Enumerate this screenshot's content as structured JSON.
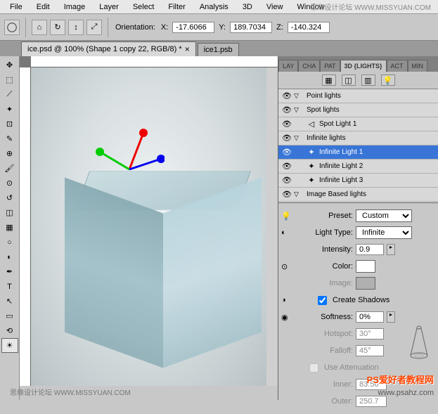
{
  "menu": {
    "file": "File",
    "edit": "Edit",
    "image": "Image",
    "layer": "Layer",
    "select": "Select",
    "filter": "Filter",
    "analysis": "Analysis",
    "threed": "3D",
    "view": "View",
    "window": "Window"
  },
  "watermark_top": "思缘设计论坛  WWW.MISSYUAN.COM",
  "options": {
    "orientation": "Orientation:",
    "x": "X:",
    "xval": "-17.6066",
    "y": "Y:",
    "yval": "189.7034",
    "z": "Z:",
    "zval": "-140.324"
  },
  "tabs": {
    "tab1": "ice.psd @ 100% (Shape 1 copy 22, RGB/8) *",
    "tab2": "ice1.psb"
  },
  "panel_tabs": {
    "lay": "LAY",
    "cha": "CHA",
    "pat": "PAT",
    "lights": "3D {LIGHTS}",
    "act": "ACT",
    "min": "MIN"
  },
  "lights": {
    "point": "Point lights",
    "spot": "Spot lights",
    "spot1": "Spot Light 1",
    "infinite": "Infinite lights",
    "inf1": "Infinite Light 1",
    "inf2": "Infinite Light 2",
    "inf3": "Infinite Light 3",
    "imgbased": "Image Based lights"
  },
  "props": {
    "preset": "Preset:",
    "preset_val": "Custom",
    "lighttype": "Light Type:",
    "lighttype_val": "Infinite",
    "intensity": "Intensity:",
    "intensity_val": "0.9",
    "color": "Color:",
    "image": "Image:",
    "shadows": "Create Shadows",
    "softness": "Softness:",
    "softness_val": "0%",
    "hotspot": "Hotspot:",
    "hotspot_val": "30°",
    "falloff": "Falloff:",
    "falloff_val": "45°",
    "atten": "Use Attenuation",
    "inner": "Inner:",
    "inner_val": "83.56",
    "outer": "Outer:",
    "outer_val": "250.7"
  },
  "wm1": "PS爱好者教程网",
  "wm2": "www.psahz.com",
  "wm3": "思缘设计论坛  WWW.MISSYUAN.COM"
}
